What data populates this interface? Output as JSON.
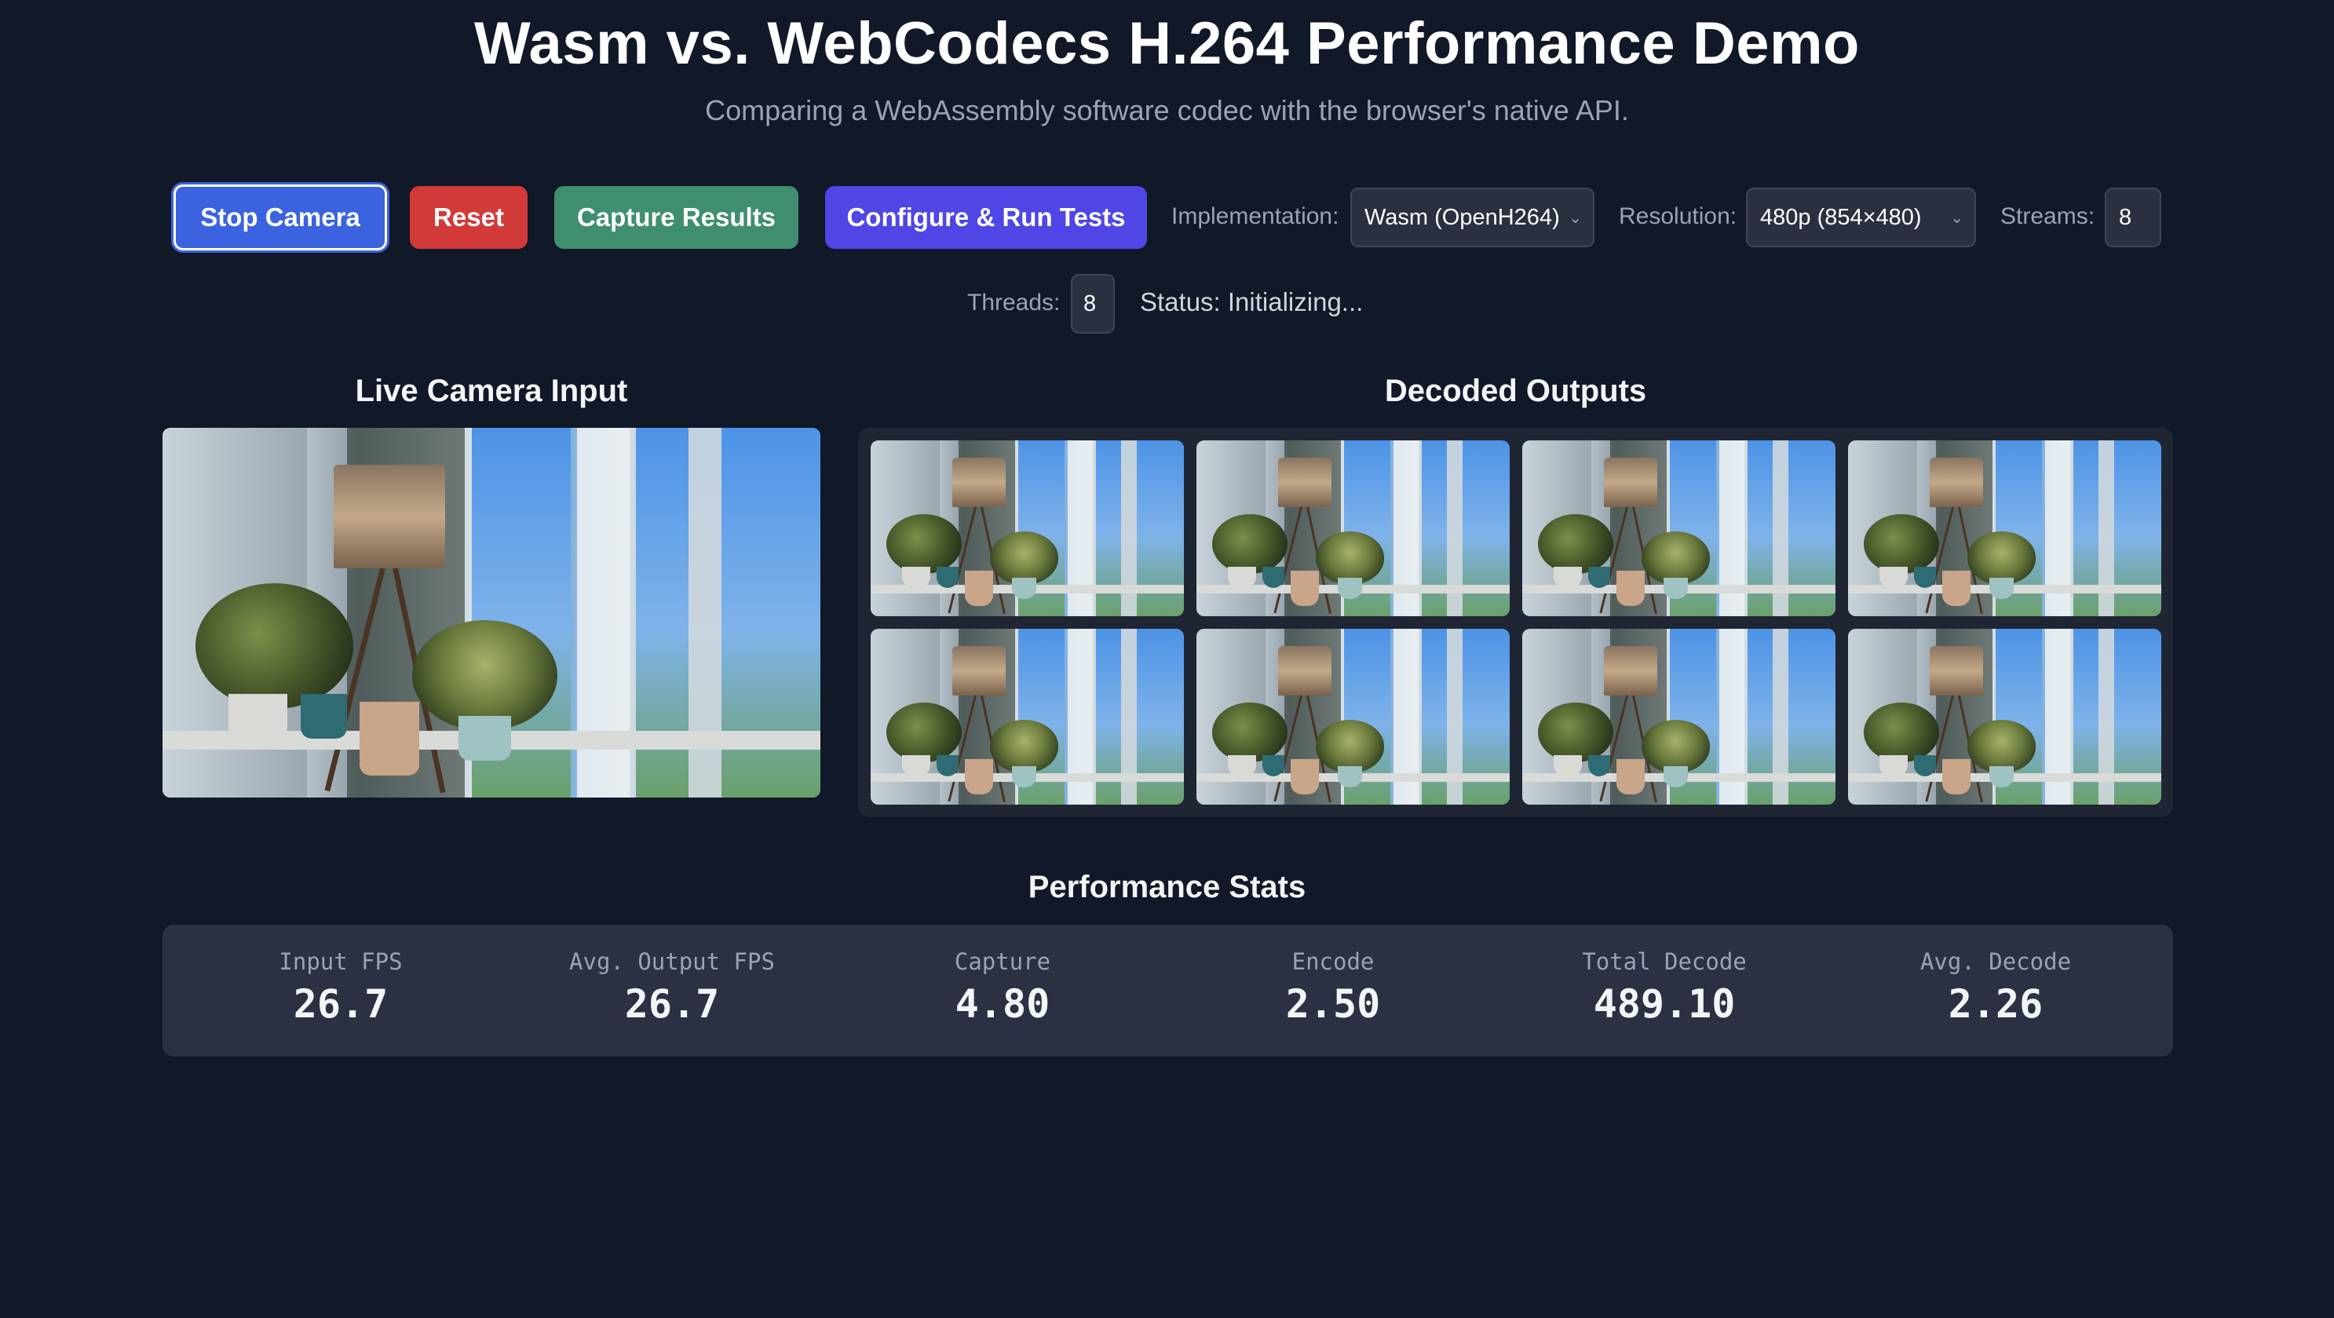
{
  "header": {
    "title": "Wasm vs. WebCodecs H.264 Performance Demo",
    "subtitle": "Comparing a WebAssembly software codec with the browser's native API."
  },
  "controls": {
    "stop_camera": "Stop Camera",
    "reset": "Reset",
    "capture_results": "Capture Results",
    "configure_run": "Configure & Run Tests",
    "implementation_label": "Implementation:",
    "implementation_value": "Wasm (OpenH264)",
    "resolution_label": "Resolution:",
    "resolution_value": "480p (854×480)",
    "streams_label": "Streams:",
    "streams_value": "8",
    "threads_label": "Threads:",
    "threads_value": "8",
    "status": "Status: Initializing..."
  },
  "sections": {
    "live_input": "Live Camera Input",
    "decoded_outputs": "Decoded Outputs",
    "performance_stats": "Performance Stats"
  },
  "stats": [
    {
      "label": "Input FPS",
      "value": "26.7"
    },
    {
      "label": "Avg. Output FPS",
      "value": "26.7"
    },
    {
      "label": "Capture",
      "value": "4.80"
    },
    {
      "label": "Encode",
      "value": "2.50"
    },
    {
      "label": "Total Decode",
      "value": "489.10"
    },
    {
      "label": "Avg. Decode",
      "value": "2.26"
    }
  ],
  "icons": {
    "select_arrow": "chevron-down-icon"
  }
}
